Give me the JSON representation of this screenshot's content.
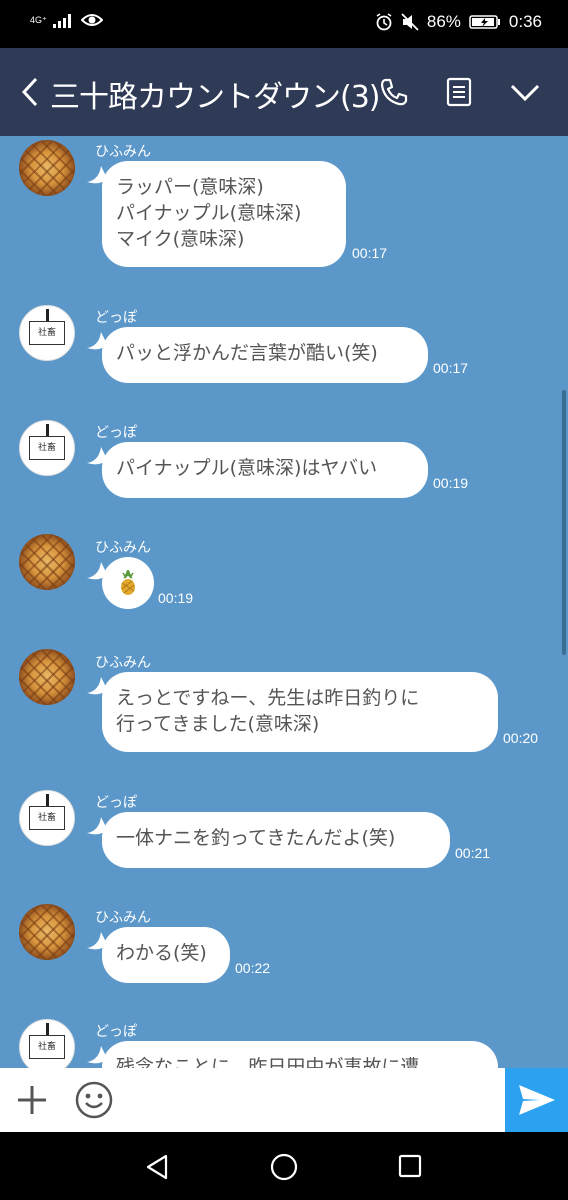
{
  "status_bar": {
    "network": "4G⁺",
    "battery": "86%",
    "time": "0:36"
  },
  "header": {
    "title": "三十路カウントダウン(3)"
  },
  "messages": [
    {
      "sender": "ひふみん",
      "lines": [
        "ラッパー(意味深)",
        "パイナップル(意味深)",
        "マイク(意味深)"
      ],
      "time": "00:17"
    },
    {
      "sender": "どっぽ",
      "lines": [
        "パッと浮かんだ言葉が酷い(笑)"
      ],
      "time": "00:17"
    },
    {
      "sender": "どっぽ",
      "lines": [
        "パイナップル(意味深)はヤバい"
      ],
      "time": "00:19"
    },
    {
      "sender": "ひふみん",
      "lines": [
        "🍍"
      ],
      "time": "00:19"
    },
    {
      "sender": "ひふみん",
      "lines": [
        "えっとですねー、先生は昨日釣りに",
        "行ってきました(意味深)"
      ],
      "time": "00:20"
    },
    {
      "sender": "どっぽ",
      "lines": [
        "一体ナニを釣ってきたんだよ(笑)"
      ],
      "time": "00:21"
    },
    {
      "sender": "ひふみん",
      "lines": [
        "わかる(笑)"
      ],
      "time": "00:22"
    },
    {
      "sender": "どっぽ",
      "lines": [
        "残念なことに、昨日田中が事故に遭"
      ],
      "time": ""
    }
  ],
  "avatar_card_text": "社畜",
  "colors": {
    "chat_background": "#5b98c9",
    "header": "#2f3a56",
    "send_button": "#2ba1f0"
  }
}
